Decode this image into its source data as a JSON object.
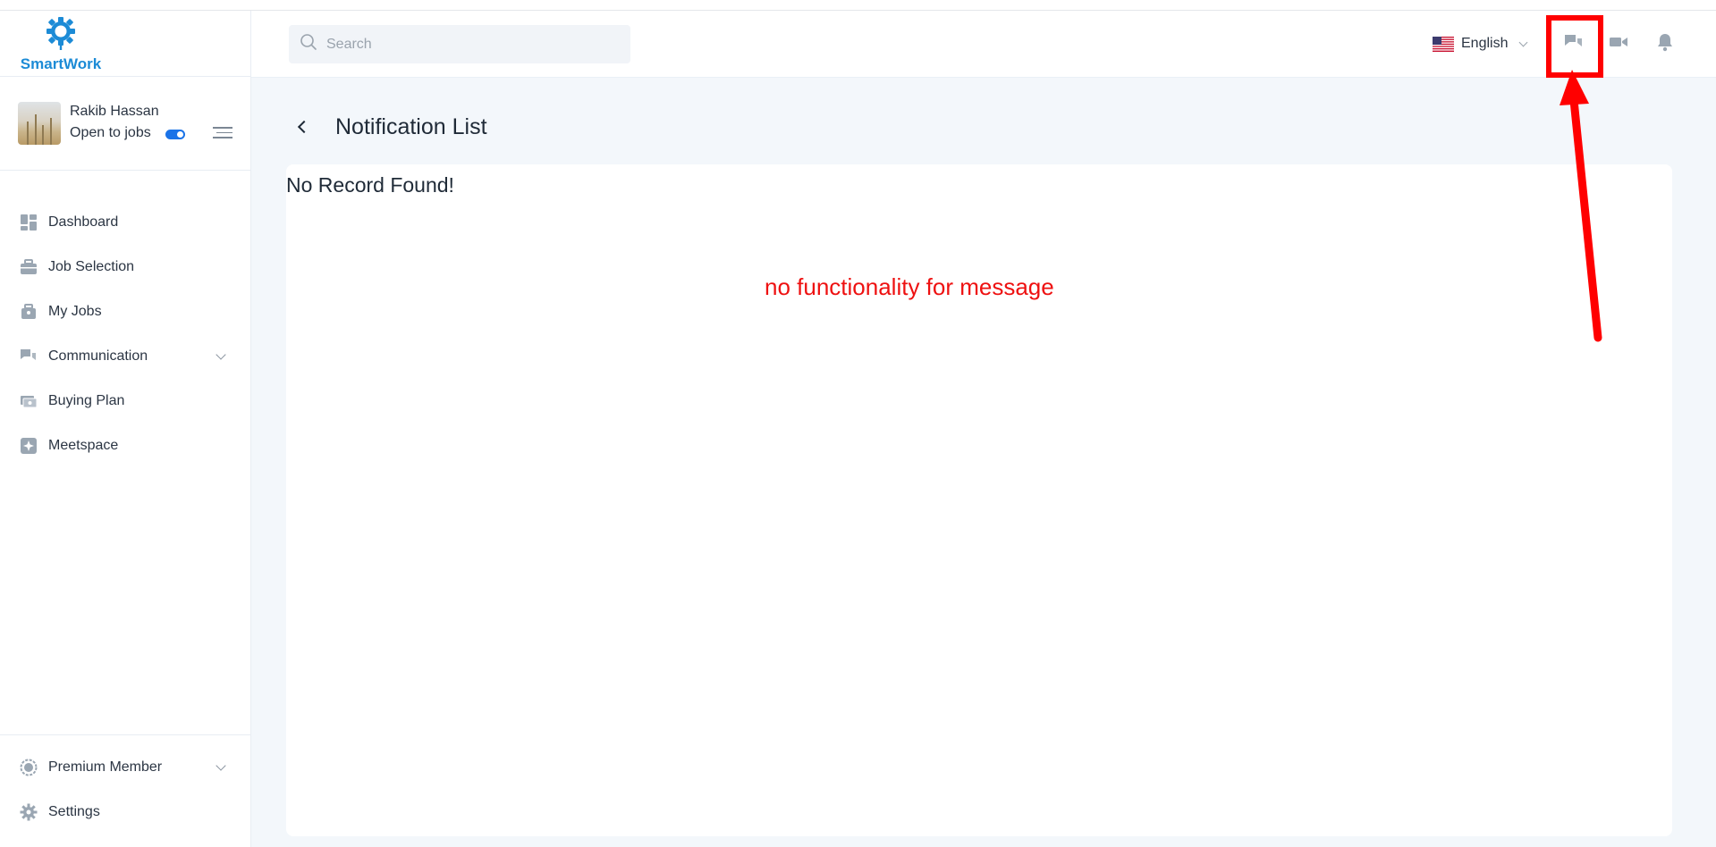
{
  "app": {
    "logo_text": "SmartWork"
  },
  "profile": {
    "name": "Rakib Hassan",
    "status": "Open to jobs",
    "open_to_jobs": true
  },
  "sidebar": {
    "items": [
      {
        "label": "Dashboard",
        "icon": "dashboard-icon"
      },
      {
        "label": "Job Selection",
        "icon": "briefcase-icon"
      },
      {
        "label": "My Jobs",
        "icon": "job-bag-icon"
      },
      {
        "label": "Communication",
        "icon": "chat-icon",
        "expandable": true
      },
      {
        "label": "Buying Plan",
        "icon": "money-icon"
      },
      {
        "label": "Meetspace",
        "icon": "sparkle-icon"
      }
    ],
    "bottom_items": [
      {
        "label": "Premium Member",
        "icon": "badge-icon",
        "expandable": true
      },
      {
        "label": "Settings",
        "icon": "gear-icon"
      }
    ]
  },
  "header": {
    "search_placeholder": "Search",
    "language": "English",
    "icons": [
      "chat-icon",
      "video-icon",
      "bell-icon"
    ]
  },
  "page": {
    "title": "Notification List",
    "empty_message": "No Record Found!"
  },
  "annotation": {
    "note": "no functionality for message",
    "color": "#ff0000"
  }
}
